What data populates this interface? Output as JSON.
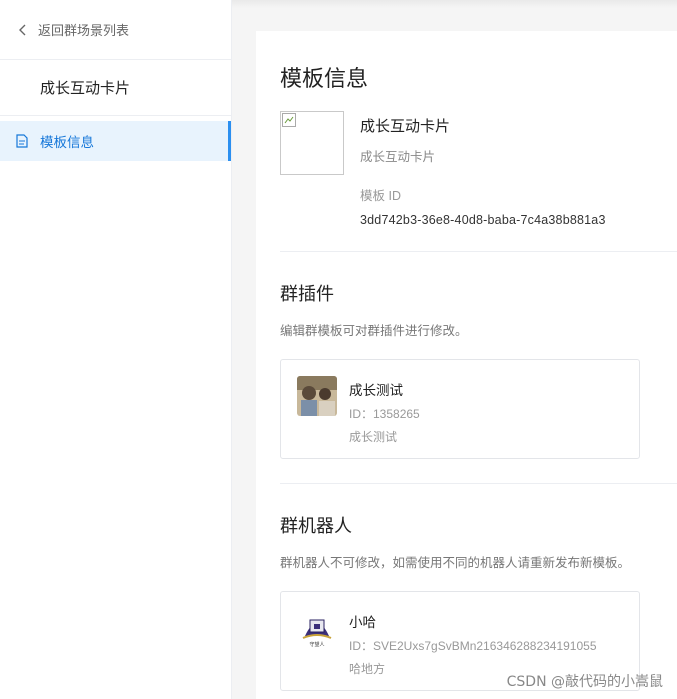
{
  "sidebar": {
    "back_label": "返回群场景列表",
    "title": "成长互动卡片",
    "active_item": "模板信息"
  },
  "template": {
    "heading": "模板信息",
    "name": "成长互动卡片",
    "subtitle": "成长互动卡片",
    "id_label": "模板 ID",
    "id": "3dd742b3-36e8-40d8-baba-7c4a38b881a3"
  },
  "plugins": {
    "heading": "群插件",
    "description": "编辑群模板可对群插件进行修改。",
    "card": {
      "name": "成长测试",
      "id_line": "ID：1358265",
      "desc": "成长测试"
    }
  },
  "robots": {
    "heading": "群机器人",
    "description": "群机器人不可修改，如需使用不同的机器人请重新发布新模板。",
    "card": {
      "name": "小哈",
      "id_line": "ID：SVE2Uxs7gSvBMn216346288234191055",
      "desc": "哈地方",
      "avatar_label": "守望人"
    }
  },
  "watermark": "CSDN @敲代码的小嵩鼠",
  "colors": {
    "accent": "#2b8ff0",
    "active_bg": "#e8f3fd",
    "active_text": "#1677d9"
  }
}
